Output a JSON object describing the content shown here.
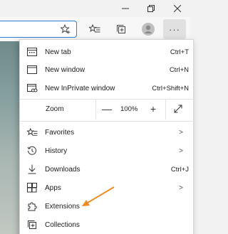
{
  "menu": {
    "new_tab": {
      "label": "New tab",
      "shortcut": "Ctrl+T"
    },
    "new_window": {
      "label": "New window",
      "shortcut": "Ctrl+N"
    },
    "new_inprivate": {
      "label": "New InPrivate window",
      "shortcut": "Ctrl+Shift+N"
    },
    "zoom": {
      "label": "Zoom",
      "minus": "—",
      "value": "100%",
      "plus": "+"
    },
    "favorites": {
      "label": "Favorites",
      "chevron": ">"
    },
    "history": {
      "label": "History",
      "chevron": ">"
    },
    "downloads": {
      "label": "Downloads",
      "shortcut": "Ctrl+J"
    },
    "apps": {
      "label": "Apps",
      "chevron": ">"
    },
    "extensions": {
      "label": "Extensions"
    },
    "collections": {
      "label": "Collections"
    }
  },
  "toolbar": {
    "more_label": "···"
  },
  "colors": {
    "address_border": "#2b7bd6",
    "arrow": "#f08a24"
  }
}
